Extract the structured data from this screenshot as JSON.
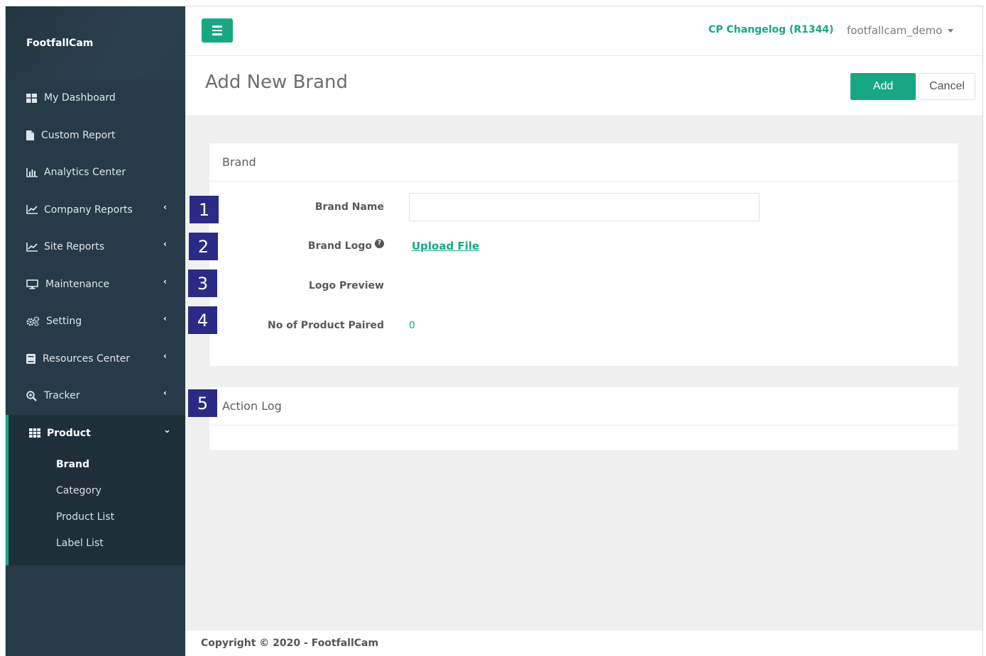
{
  "app": {
    "logo_text": "FootfallCam"
  },
  "sidebar": {
    "items": [
      {
        "label": "My Dashboard",
        "icon": "dashboard-icon",
        "has_submenu": false
      },
      {
        "label": "Custom Report",
        "icon": "file-icon",
        "has_submenu": false
      },
      {
        "label": "Analytics Center",
        "icon": "bar-chart-icon",
        "has_submenu": false
      },
      {
        "label": "Company Reports",
        "icon": "line-chart-icon",
        "has_submenu": true
      },
      {
        "label": "Site Reports",
        "icon": "line-chart-icon",
        "has_submenu": true
      },
      {
        "label": "Maintenance",
        "icon": "monitor-icon",
        "has_submenu": true
      },
      {
        "label": "Setting",
        "icon": "gears-icon",
        "has_submenu": true
      },
      {
        "label": "Resources Center",
        "icon": "book-icon",
        "has_submenu": true
      },
      {
        "label": "Tracker",
        "icon": "search-plus-icon",
        "has_submenu": true
      }
    ],
    "active_section": {
      "label": "Product",
      "icon": "grid-icon",
      "subitems": [
        {
          "label": "Brand",
          "current": true
        },
        {
          "label": "Category",
          "current": false
        },
        {
          "label": "Product List",
          "current": false
        },
        {
          "label": "Label List",
          "current": false
        }
      ]
    }
  },
  "topbar": {
    "changelog": "CP Changelog (R1344)",
    "user": "footfallcam_demo"
  },
  "page": {
    "title": "Add New Brand",
    "add_label": "Add",
    "cancel_label": "Cancel"
  },
  "brand_panel": {
    "title": "Brand",
    "brand_name_label": "Brand Name",
    "brand_name_value": "",
    "brand_logo_label": "Brand Logo",
    "upload_label": "Upload File",
    "logo_preview_label": "Logo Preview",
    "paired_label": "No of Product Paired",
    "paired_value": "0"
  },
  "action_log_panel": {
    "title": "Action Log"
  },
  "markers": [
    "1",
    "2",
    "3",
    "4",
    "5"
  ],
  "footer": {
    "text": "Copyright © 2020 - FootfallCam"
  },
  "colors": {
    "accent": "#17a883",
    "sidebar": "#273a47",
    "marker": "#2b2b86"
  }
}
